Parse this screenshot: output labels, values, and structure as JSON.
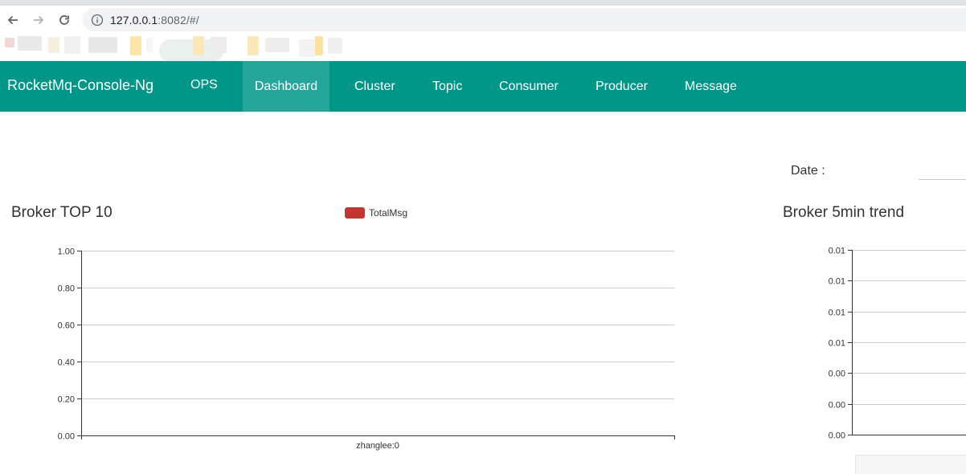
{
  "browser": {
    "url_host": "127.0.0.1",
    "url_rest": ":8082/#/"
  },
  "navbar": {
    "brand": "RocketMq-Console-Ng",
    "items": [
      {
        "label": "OPS"
      },
      {
        "label": "Dashboard"
      },
      {
        "label": "Cluster"
      },
      {
        "label": "Topic"
      },
      {
        "label": "Consumer"
      },
      {
        "label": "Producer"
      },
      {
        "label": "Message"
      }
    ],
    "active_item": "Dashboard",
    "bg_color": "#009688",
    "active_color": "#26a69a"
  },
  "date": {
    "label": "Date :",
    "value": ""
  },
  "broker_top10": {
    "title": "Broker TOP 10"
  },
  "broker_trend": {
    "title": "Broker 5min trend"
  },
  "chart_data": [
    {
      "type": "bar",
      "title": "Broker TOP 10",
      "categories": [
        "zhanglee:0"
      ],
      "series": [
        {
          "name": "TotalMsg",
          "values": [
            0
          ],
          "color": "#c23531"
        }
      ],
      "y_ticks": [
        "0.00",
        "0.20",
        "0.40",
        "0.60",
        "0.80",
        "1.00"
      ],
      "ylim": [
        0,
        1
      ],
      "grid": true,
      "legend": "top-center"
    },
    {
      "type": "line",
      "title": "Broker 5min trend",
      "series": [],
      "y_ticks": [
        "0.00",
        "0.00",
        "0.00",
        "0.01",
        "0.01",
        "0.01",
        "0.01"
      ],
      "grid": true
    }
  ]
}
